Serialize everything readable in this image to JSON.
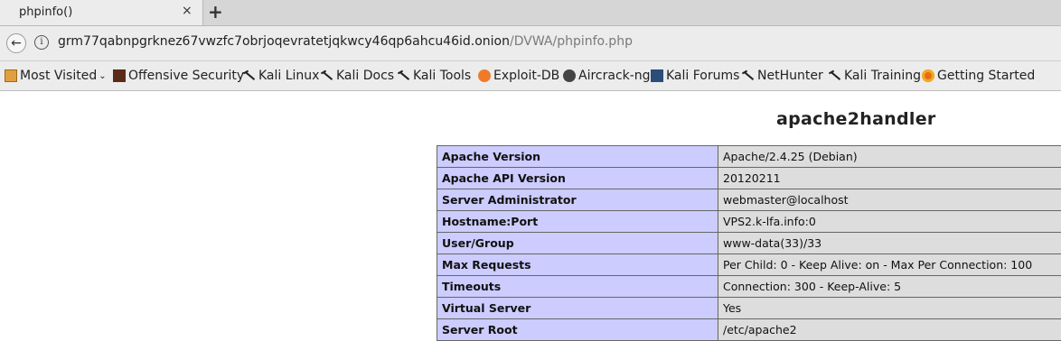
{
  "tab": {
    "title": "phpinfo()",
    "close": "×",
    "new_tab": "+"
  },
  "nav": {
    "url_host": "grm77qabnpgrknez67vwzfc7obrjoqevratetjqkwcy46qp6ahcu46id.onion",
    "url_path": "/DVWA/phpinfo.php"
  },
  "bookmarks": [
    {
      "label": "Most Visited",
      "icon": "folder-icon"
    },
    {
      "label": "Offensive Security",
      "icon": "offsec-icon"
    },
    {
      "label": "Kali Linux",
      "icon": "kali-dragon-icon"
    },
    {
      "label": "Kali Docs",
      "icon": "kali-dragon-icon"
    },
    {
      "label": "Kali Tools",
      "icon": "kali-dragon-icon"
    },
    {
      "label": "Exploit-DB",
      "icon": "exploitdb-icon"
    },
    {
      "label": "Aircrack-ng",
      "icon": "aircrack-icon"
    },
    {
      "label": "Kali Forums",
      "icon": "forums-icon"
    },
    {
      "label": "NetHunter",
      "icon": "kali-dragon-icon"
    },
    {
      "label": "Kali Training",
      "icon": "kali-dragon-icon"
    },
    {
      "label": "Getting Started",
      "icon": "firefox-icon"
    }
  ],
  "page": {
    "section_title": "apache2handler",
    "rows": [
      {
        "key": "Apache Version",
        "value": "Apache/2.4.25 (Debian)"
      },
      {
        "key": "Apache API Version",
        "value": "20120211"
      },
      {
        "key": "Server Administrator",
        "value": "webmaster@localhost"
      },
      {
        "key": "Hostname:Port",
        "value": "VPS2.k-lfa.info:0"
      },
      {
        "key": "User/Group",
        "value": "www-data(33)/33"
      },
      {
        "key": "Max Requests",
        "value": "Per Child: 0 - Keep Alive: on - Max Per Connection: 100"
      },
      {
        "key": "Timeouts",
        "value": "Connection: 300 - Keep-Alive: 5"
      },
      {
        "key": "Virtual Server",
        "value": "Yes"
      },
      {
        "key": "Server Root",
        "value": "/etc/apache2"
      }
    ]
  }
}
